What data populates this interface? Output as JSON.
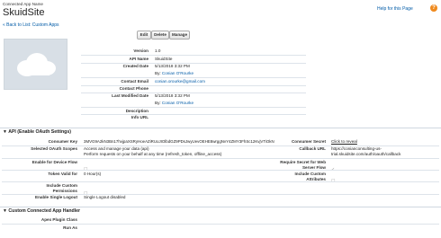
{
  "header": {
    "subtitle": "Connected App Name",
    "title": "SkuidSite",
    "help_link": "Help for this Page",
    "back_link": "« Back to List: Custom Apps"
  },
  "buttons": {
    "edit": "Edit",
    "delete": "Delete",
    "manage": "Manage"
  },
  "detail": {
    "version_label": "Version",
    "version": "1.0",
    "api_name_label": "API Name",
    "api_name": "SkuidSite",
    "created_date_label": "Created Date",
    "created_date": "5/13/2018 3:32 PM",
    "created_by": "By: Conian O'Rourke",
    "contact_email_label": "Contact Email",
    "contact_email": "conian.orourke@gmail.com",
    "contact_phone_label": "Contact Phone",
    "contact_phone": "",
    "last_modified_label": "Last Modified Date",
    "last_modified": "5/13/2018 3:32 PM",
    "modified_by": "By: Conian O'Rourke",
    "description_label": "Description",
    "description": "",
    "info_url_label": "Info URL",
    "info_url": ""
  },
  "api_section": {
    "title": "API (Enable OAuth Settings)",
    "consumer_key_label": "Consumer Key",
    "consumer_key": "3MVG9A2kN3Bn17hvjpaXSRyHoeAZiRUoJIOlbdGZ9PDsJwyUevOEHE8wrggNvY4ZMY3FhSc12KvjVTiOkN",
    "consumer_secret_label": "Consumer Secret",
    "consumer_secret": "Click to reveal",
    "scopes_label": "Selected OAuth Scopes",
    "scope_1": "Access and manage your data (api)",
    "scope_2": "Perform requests on your behalf at any time (refresh_token, offline_access)",
    "callback_label": "Callback URL",
    "callback_1": "https://conianconsulting-us-",
    "callback_2": "trial.skuidsite.com/auth/oauth/callback",
    "device_flow_label": "Enable for Device Flow",
    "require_secret_label_1": "Require Secret for Web",
    "require_secret_label_2": "Server Flow",
    "token_valid_label": "Token Valid for",
    "token_valid": "0 Hour(s)",
    "custom_attr_label_1": "Include Custom",
    "custom_attr_label_2": "Attributes",
    "custom_perm_label_1": "Include Custom",
    "custom_perm_label_2": "Permissions",
    "single_logout_label": "Enable Single Logout",
    "single_logout": "Single Logout disabled"
  },
  "handler_section": {
    "title": "Custom Connected App Handler",
    "apex_label": "Apex Plugin Class",
    "run_as_label": "Run As"
  }
}
